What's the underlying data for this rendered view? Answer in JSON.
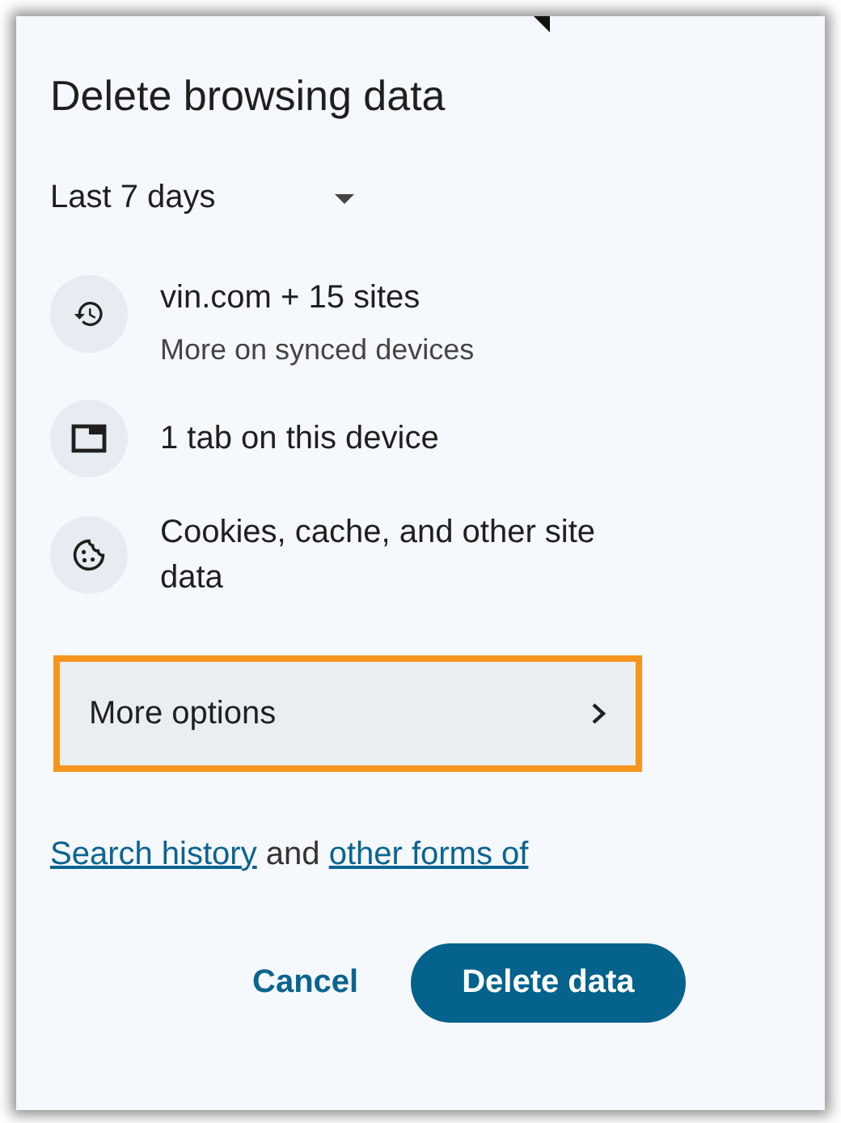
{
  "dialog": {
    "title": "Delete browsing data",
    "time_range": {
      "value": "Last 7 days"
    },
    "items": [
      {
        "kind": "history",
        "label": "vin.com + 15 sites",
        "detail": "More on synced devices"
      },
      {
        "kind": "tabs",
        "label": "1 tab on this device"
      },
      {
        "kind": "cookies",
        "label": "Cookies, cache, and other site data"
      }
    ],
    "more_options": {
      "label": "More options",
      "highlighted": true
    },
    "notice_lines": [
      [
        {
          "kind": "link",
          "text": "Search history"
        },
        {
          "kind": "text",
          "text": " and "
        },
        {
          "kind": "link",
          "text": "other forms of"
        }
      ]
    ],
    "buttons": [
      {
        "kind": "text",
        "label": "Cancel"
      },
      {
        "kind": "filled",
        "label": "Delete data"
      }
    ]
  }
}
